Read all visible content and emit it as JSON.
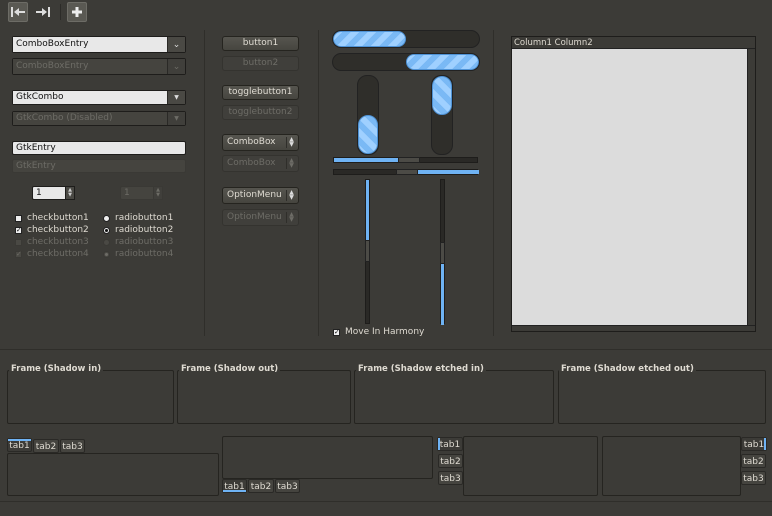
{
  "toolbar": {
    "buttons": [
      "goto-first-icon",
      "goto-last-icon",
      "add-icon"
    ]
  },
  "col1": {
    "combo_entry": "ComboBoxEntry",
    "combo_entry_disabled": "ComboBoxEntry",
    "gtk_combo": "GtkCombo",
    "gtk_combo_disabled": "GtkCombo (Disabled)",
    "gtk_entry": "GtkEntry",
    "gtk_entry_disabled": "GtkEntry",
    "spin_value": "1",
    "spin_disabled_value": "1",
    "checks": [
      "checkbutton1",
      "checkbutton2",
      "checkbutton3",
      "checkbutton4"
    ],
    "radios": [
      "radiobutton1",
      "radiobutton2",
      "radiobutton3",
      "radiobutton4"
    ]
  },
  "col2": {
    "button1": "button1",
    "button2": "button2",
    "toggle1": "togglebutton1",
    "toggle2": "togglebutton2",
    "combobox": "ComboBox",
    "combobox_disabled": "ComboBox",
    "optionmenu": "OptionMenu",
    "optionmenu_disabled": "OptionMenu"
  },
  "col3": {
    "hprogress_values": [
      0.5,
      0.5
    ],
    "vprogress_values": [
      0.5,
      0.5
    ],
    "move_in_harmony": "Move In Harmony",
    "move_in_harmony_checked": true
  },
  "tree": {
    "header": "Column1 Column2"
  },
  "frames": [
    "Frame (Shadow in)",
    "Frame (Shadow out)",
    "Frame (Shadow etched in)",
    "Frame (Shadow etched out)"
  ],
  "notebooks": [
    {
      "tabs": [
        "tab1",
        "tab2",
        "tab3"
      ],
      "position": "top"
    },
    {
      "tabs": [
        "tab1",
        "tab2",
        "tab3"
      ],
      "position": "bottom"
    },
    {
      "tabs": [
        "tab1",
        "tab2",
        "tab3"
      ],
      "position": "left"
    },
    {
      "tabs": [
        "tab1",
        "tab2",
        "tab3"
      ],
      "position": "right"
    }
  ],
  "colors": {
    "accent": "#6fb3f4",
    "background": "#3c3b37"
  }
}
